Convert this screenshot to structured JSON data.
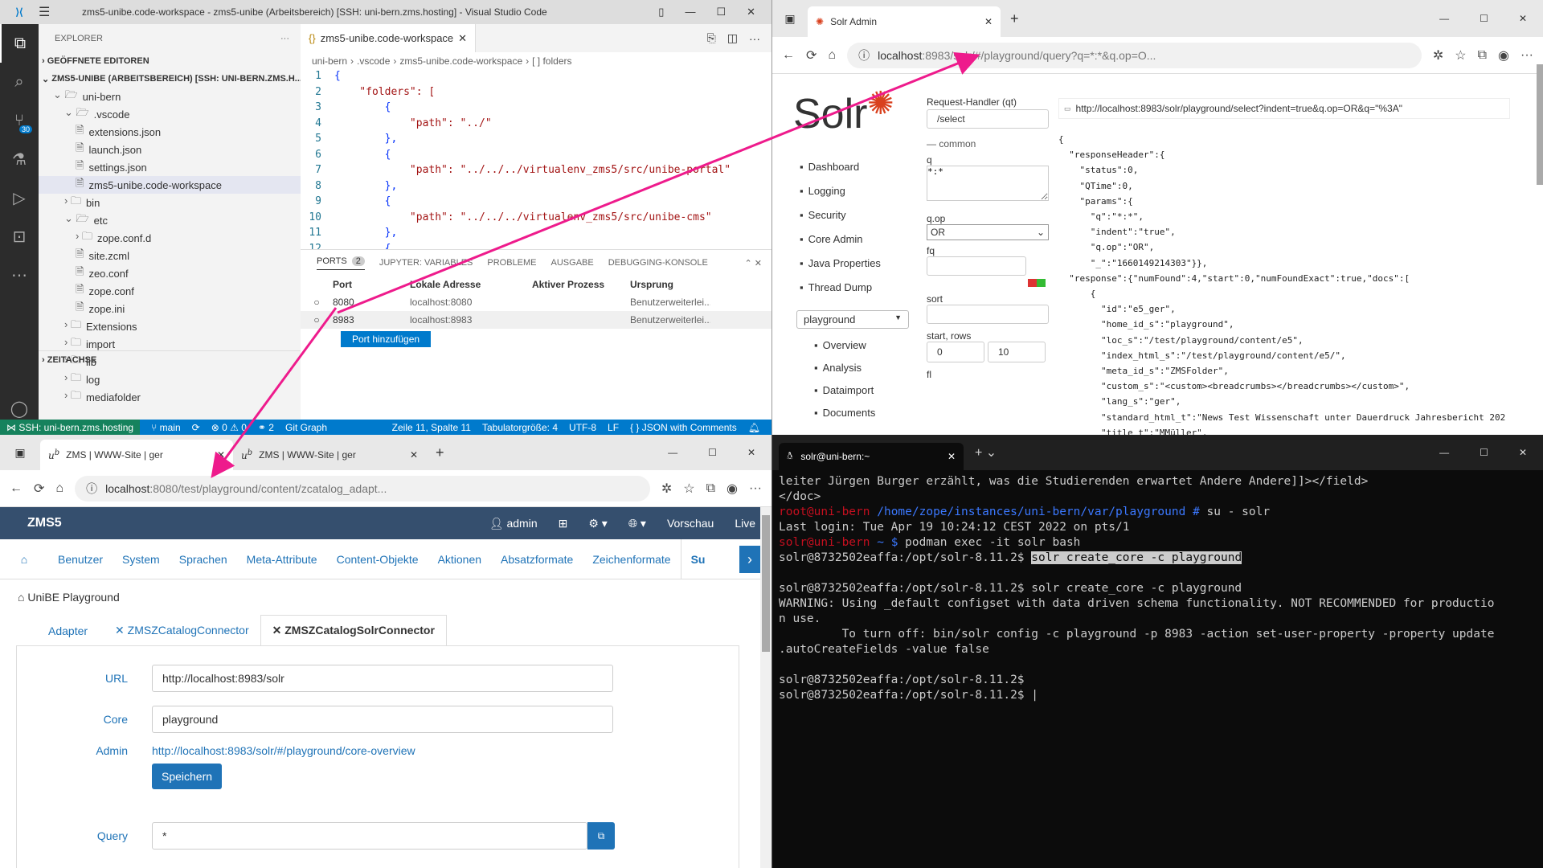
{
  "vscode": {
    "title": "zms5-unibe.code-workspace - zms5-unibe (Arbeitsbereich) [SSH: uni-bern.zms.hosting] - Visual Studio Code",
    "explorer_label": "EXPLORER",
    "open_editors": "GEÖFFNETE EDITOREN",
    "workspace_root": "ZMS5-UNIBE (ARBEITSBEREICH) [SSH: UNI-BERN.ZMS.H...",
    "tree": [
      "uni-bern",
      ".vscode",
      "extensions.json",
      "launch.json",
      "settings.json",
      "zms5-unibe.code-workspace",
      "bin",
      "etc",
      "zope.conf.d",
      "site.zcml",
      "zeo.conf",
      "zope.conf",
      "zope.ini",
      "Extensions",
      "import",
      "lib",
      "log",
      "mediafolder"
    ],
    "timeline": "ZEITACHSE",
    "scm_badge": "30",
    "tab_label": "zms5-unibe.code-workspace",
    "breadcrumbs": [
      "uni-bern",
      ".vscode",
      "zms5-unibe.code-workspace",
      "[ ] folders"
    ],
    "code": [
      "{",
      "    \"folders\": [",
      "        {",
      "            \"path\": \"../\"",
      "        },",
      "        {",
      "            \"path\": \"../../../virtualenv_zms5/src/unibe-portal\"",
      "        },",
      "        {",
      "            \"path\": \"../../../virtualenv_zms5/src/unibe-cms\"",
      "        },",
      "        {"
    ],
    "panel_tabs": [
      "PORTS",
      "JUPYTER: VARIABLES",
      "PROBLEME",
      "AUSGABE",
      "DEBUGGING-KONSOLE"
    ],
    "ports_badge": "2",
    "ports_headers": [
      "Port",
      "Lokale Adresse",
      "Aktiver Prozess",
      "Ursprung"
    ],
    "ports": [
      {
        "port": "8080",
        "addr": "localhost:8080",
        "proc": "",
        "origin": "Benutzerweiterlei..."
      },
      {
        "port": "8983",
        "addr": "localhost:8983",
        "proc": "",
        "origin": "Benutzerweiterlei..."
      }
    ],
    "add_port": "Port hinzufügen",
    "status": {
      "remote": "SSH: uni-bern.zms.hosting",
      "branch": "main",
      "errors": "0",
      "warnings": "0",
      "ports": "2",
      "graph": "Git Graph",
      "pos": "Zeile 11, Spalte 11",
      "tabsize": "Tabulatorgröße: 4",
      "enc": "UTF-8",
      "eol": "LF",
      "lang": "JSON with Comments"
    }
  },
  "solr": {
    "tab_title": "Solr Admin",
    "url_host": "localhost",
    "url_rest": ":8983/solr/#/playground/query?q=*:*&q.op=O...",
    "logo_text": "Solr",
    "nav": [
      "Dashboard",
      "Logging",
      "Security",
      "Core Admin",
      "Java Properties",
      "Thread Dump"
    ],
    "core_select": "playground",
    "core_nav": [
      "Overview",
      "Analysis",
      "Dataimport",
      "Documents"
    ],
    "form": {
      "handler_label": "Request-Handler (qt)",
      "handler": "/select",
      "common": "common",
      "q_label": "q",
      "q": "*:*",
      "qop_label": "q.op",
      "qop": "OR",
      "fq_label": "fq",
      "sort_label": "sort",
      "rows_label": "start, rows",
      "start": "0",
      "rows": "10",
      "fl_label": "fl"
    },
    "result_url": "http://localhost:8983/solr/playground/select?indent=true&q.op=OR&q=\"%3A\"",
    "json": [
      "{",
      "  \"responseHeader\":{",
      "    \"status\":0,",
      "    \"QTime\":0,",
      "    \"params\":{",
      "      \"q\":\"*:*\",",
      "      \"indent\":\"true\",",
      "      \"q.op\":\"OR\",",
      "      \"_\":\"1660149214303\"}},",
      "  \"response\":{\"numFound\":4,\"start\":0,\"numFoundExact\":true,\"docs\":[",
      "      {",
      "        \"id\":\"e5_ger\",",
      "        \"home_id_s\":\"playground\",",
      "        \"loc_s\":\"/test/playground/content/e5\",",
      "        \"index_html_s\":\"/test/playground/content/e5/\",",
      "        \"meta_id_s\":\"ZMSFolder\",",
      "        \"custom_s\":\"<custom><breadcrumbs></breadcrumbs></custom>\",",
      "        \"lang_s\":\"ger\",",
      "        \"standard_html_t\":\"News Test Wissenschaft unter Dauerdruck Jahresbericht 202",
      "        \"title_t\":\"MMüller\","
    ]
  },
  "zms": {
    "tabs": [
      "ZMS | WWW-Site | ger",
      "ZMS | WWW-Site | ger"
    ],
    "url_host": "localhost",
    "url_rest": ":8080/test/playground/content/zcatalog_adapt...",
    "brand": "ZMS5",
    "user": "admin",
    "preview": "Vorschau",
    "live": "Live",
    "menu": [
      "Benutzer",
      "System",
      "Sprachen",
      "Meta-Attribute",
      "Content-Objekte",
      "Aktionen",
      "Absatzformate",
      "Zeichenformate",
      "Su"
    ],
    "breadcrumb": "UniBE Playground",
    "subtabs": [
      "Adapter",
      "ZMSZCatalogConnector",
      "ZMSZCatalogSolrConnector"
    ],
    "url_label": "URL",
    "url_value": "http://localhost:8983/solr",
    "core_label": "Core",
    "core_value": "playground",
    "admin_label": "Admin",
    "admin_link": "http://localhost:8983/solr/#/playground/core-overview",
    "save": "Speichern",
    "query_label": "Query",
    "query_value": "*"
  },
  "terminal": {
    "tab_title": "solr@uni-bern:~",
    "lines": [
      {
        "t": "leiter Jürgen Burger erzählt, was die Studierenden erwartet Andere Andere]]></field>"
      },
      {
        "t": "</doc>"
      },
      {
        "a": "root@uni-bern",
        "b": " /home/zope/instances/uni-bern/var/playground # ",
        "c": "su - solr"
      },
      {
        "t": "Last login: Tue Apr 19 10:24:12 CEST 2022 on pts/1"
      },
      {
        "a": "solr@uni-bern",
        "b": " ~ $ ",
        "c": "podman exec -it solr bash"
      },
      {
        "p": "solr@8732502eaffa:/opt/solr-8.11.2$ ",
        "h": "solr create_core -c playground"
      },
      {
        "t": ""
      },
      {
        "t": "solr@8732502eaffa:/opt/solr-8.11.2$ solr create_core -c playground"
      },
      {
        "t": "WARNING: Using _default configset with data driven schema functionality. NOT RECOMMENDED for productio"
      },
      {
        "t": "n use."
      },
      {
        "t": "         To turn off: bin/solr config -c playground -p 8983 -action set-user-property -property update"
      },
      {
        "t": ".autoCreateFields -value false"
      },
      {
        "t": ""
      },
      {
        "t": "solr@8732502eaffa:/opt/solr-8.11.2$"
      },
      {
        "t": "solr@8732502eaffa:/opt/solr-8.11.2$ |"
      }
    ]
  },
  "colors": {
    "arrow": "#ee1b8c",
    "vscode_status": "#007acc",
    "zms_header": "#354f6e",
    "zms_link": "#1f73b7",
    "solr_red": "#d9411e"
  }
}
